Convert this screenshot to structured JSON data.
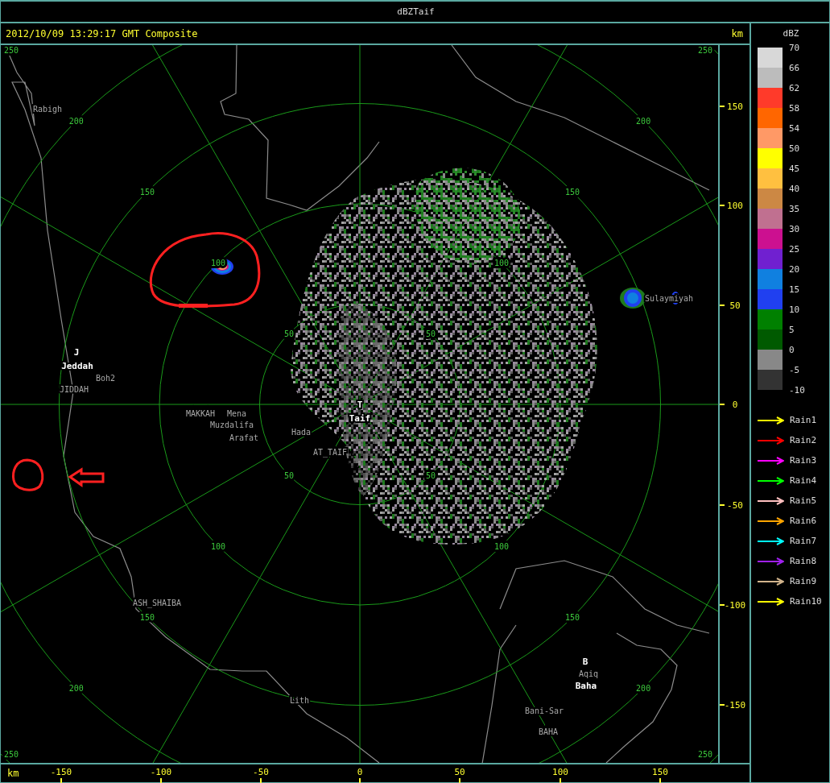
{
  "window": {
    "title": "dBZTaif"
  },
  "header": {
    "timestamp": "2012/10/09 13:29:17 GMT Composite",
    "unit": "km"
  },
  "y_axis": {
    "ticks": [
      "150",
      "100",
      "50",
      "0",
      "-50",
      "-100",
      "-150"
    ]
  },
  "x_axis": {
    "unit": "km",
    "ticks": [
      "-150",
      "-100",
      "-50",
      "0",
      "50",
      "100",
      "150"
    ]
  },
  "map": {
    "rings": [
      {
        "labels": [
          "50",
          "50",
          "50",
          "50"
        ]
      },
      {
        "labels": [
          "100",
          "100",
          "100",
          "100"
        ]
      },
      {
        "labels": [
          "150",
          "150",
          "150",
          "150"
        ]
      },
      {
        "labels": [
          "200",
          "200",
          "200",
          "200"
        ]
      },
      {
        "labels": [
          "250",
          "250",
          "250",
          "250"
        ]
      }
    ],
    "places": [
      {
        "name": "Rabigh",
        "kind": "town"
      },
      {
        "name": "J",
        "kind": "station"
      },
      {
        "name": "Jeddah",
        "kind": "station"
      },
      {
        "name": "Boh2",
        "kind": "town"
      },
      {
        "name": "JIDDAH",
        "kind": "town"
      },
      {
        "name": "MAKKAH",
        "kind": "town"
      },
      {
        "name": "Mena",
        "kind": "town"
      },
      {
        "name": "Muzdalifa",
        "kind": "town"
      },
      {
        "name": "Arafat",
        "kind": "town"
      },
      {
        "name": "Hada",
        "kind": "town"
      },
      {
        "name": "AT_TAIF",
        "kind": "town"
      },
      {
        "name": "T",
        "kind": "station"
      },
      {
        "name": "Taif",
        "kind": "station"
      },
      {
        "name": "Sulaymiyah",
        "kind": "town"
      },
      {
        "name": "ASH_SHAIBA",
        "kind": "town"
      },
      {
        "name": "Lith",
        "kind": "town"
      },
      {
        "name": "B",
        "kind": "station"
      },
      {
        "name": "Aqiq",
        "kind": "town"
      },
      {
        "name": "Baha",
        "kind": "station"
      },
      {
        "name": "Bani-Sar",
        "kind": "town"
      },
      {
        "name": "BAHA",
        "kind": "town"
      }
    ]
  },
  "legend": {
    "unit": "dBZ",
    "bins": [
      {
        "color": "#d8d8d8"
      },
      {
        "color": "#bcbcbc"
      },
      {
        "color": "#ff3a2a"
      },
      {
        "color": "#ff6600"
      },
      {
        "color": "#ff9966"
      },
      {
        "color": "#ffff00"
      },
      {
        "color": "#ffc040"
      },
      {
        "color": "#cc8844"
      },
      {
        "color": "#c07090"
      },
      {
        "color": "#cc1090"
      },
      {
        "color": "#7020d0"
      },
      {
        "color": "#1080e0"
      },
      {
        "color": "#2040f0"
      },
      {
        "color": "#008000"
      },
      {
        "color": "#005a00"
      },
      {
        "color": "#888888"
      },
      {
        "color": "#333333"
      }
    ],
    "scale_labels": [
      "70",
      "66",
      "62",
      "58",
      "54",
      "50",
      "45",
      "40",
      "35",
      "30",
      "25",
      "20",
      "15",
      "10",
      "5",
      "0",
      "-5",
      "-10"
    ],
    "tracks": [
      {
        "label": "Rain1",
        "color": "#ffff00"
      },
      {
        "label": "Rain2",
        "color": "#ff0000"
      },
      {
        "label": "Rain3",
        "color": "#ff00ff"
      },
      {
        "label": "Rain4",
        "color": "#00ff00"
      },
      {
        "label": "Rain5",
        "color": "#ffc0c0"
      },
      {
        "label": "Rain6",
        "color": "#ffa500"
      },
      {
        "label": "Rain7",
        "color": "#00ffff"
      },
      {
        "label": "Rain8",
        "color": "#a020f0"
      },
      {
        "label": "Rain9",
        "color": "#d2b48c"
      },
      {
        "label": "Rain10",
        "color": "#ffff00"
      }
    ]
  }
}
